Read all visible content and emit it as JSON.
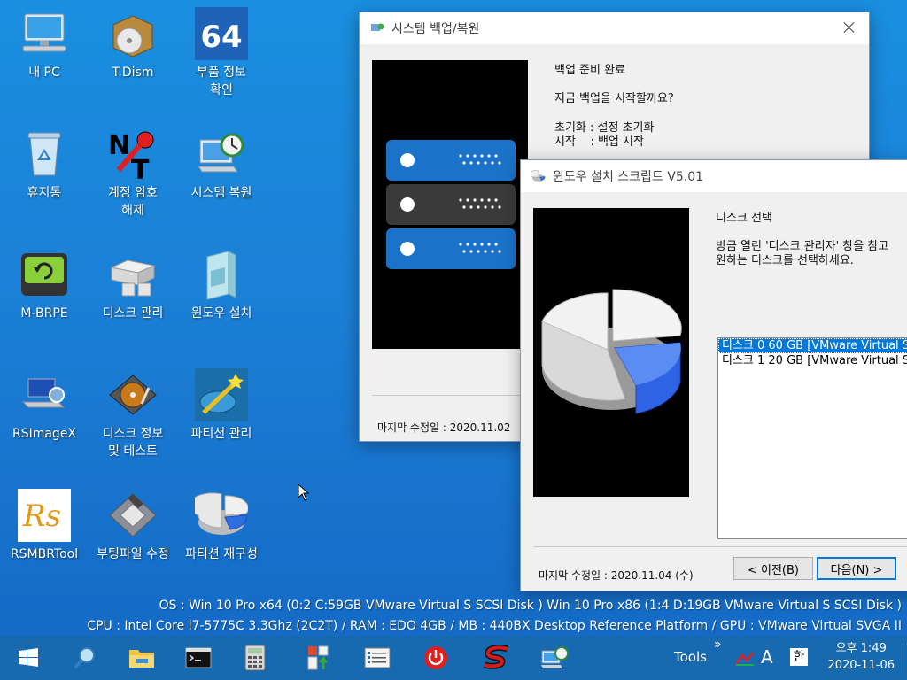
{
  "desktop": {
    "icons": [
      {
        "label": "내 PC"
      },
      {
        "label": "T.Dism"
      },
      {
        "label": "부품 정보\n확인"
      },
      {
        "label": "휴지통"
      },
      {
        "label": "계정 암호\n해제"
      },
      {
        "label": "시스템 복원"
      },
      {
        "label": "M-BRPE"
      },
      {
        "label": "디스크 관리"
      },
      {
        "label": "윈도우 설치"
      },
      {
        "label": "RSImageX"
      },
      {
        "label": "디스크 정보\n및 테스트"
      },
      {
        "label": "파티션 관리"
      },
      {
        "label": "RSMBRTool"
      },
      {
        "label": "부팅파일 수정"
      },
      {
        "label": "파티션 재구성"
      }
    ],
    "icon64_text": "64",
    "rs_text": "Rs"
  },
  "backup_window": {
    "title": "시스템 백업/복원",
    "heading": "백업 준비 완료",
    "question": "지금 백업을 시작할까요?",
    "line_reset": "초기화 : 설정 초기화",
    "line_start": "시작    : 백업 시작",
    "footer": "마지막 수정일 : 2020.11.02"
  },
  "install_window": {
    "title": "윈도우 설치 스크립트 V5.01",
    "heading": "디스크 선택",
    "desc1": "방금 열린 '디스크 관리자' 창을 참고",
    "desc2": "원하는 디스크를 선택하세요.",
    "disks": [
      "디스크 0 60 GB [VMware Virtual S",
      "디스크 1 20 GB [VMware Virtual S"
    ],
    "selected_index": 0,
    "footer": "마지막 수정일 : 2020.11.04 (수)",
    "prev_button": "< 이전(B)",
    "next_button": "다음(N) >"
  },
  "info": {
    "os_line": "OS :  Win 10 Pro x64 (0:2 C:59GB VMware Virtual S SCSI Disk ) Win 10 Pro x86 (1:4 D:19GB VMware Virtual S SCSI Disk )",
    "cpu_line": "CPU : Intel Core i7-5775C 3.3Ghz (2C2T) / RAM : EDO 4GB / MB : 440BX Desktop Reference Platform / GPU : VMware Virtual SVGA II"
  },
  "taskbar": {
    "tools_label": "Tools",
    "chevron": "»",
    "ime_lang": "A",
    "ime_korean": "한",
    "time": "오후 1:49",
    "date": "2020-11-06"
  },
  "colors": {
    "desktop_bg": "#1b7fd6",
    "taskbar_bg": "#1769b0",
    "selection": "#0078d7",
    "server_blue": "#1a73c8",
    "server_dark": "#3a3a3a"
  }
}
